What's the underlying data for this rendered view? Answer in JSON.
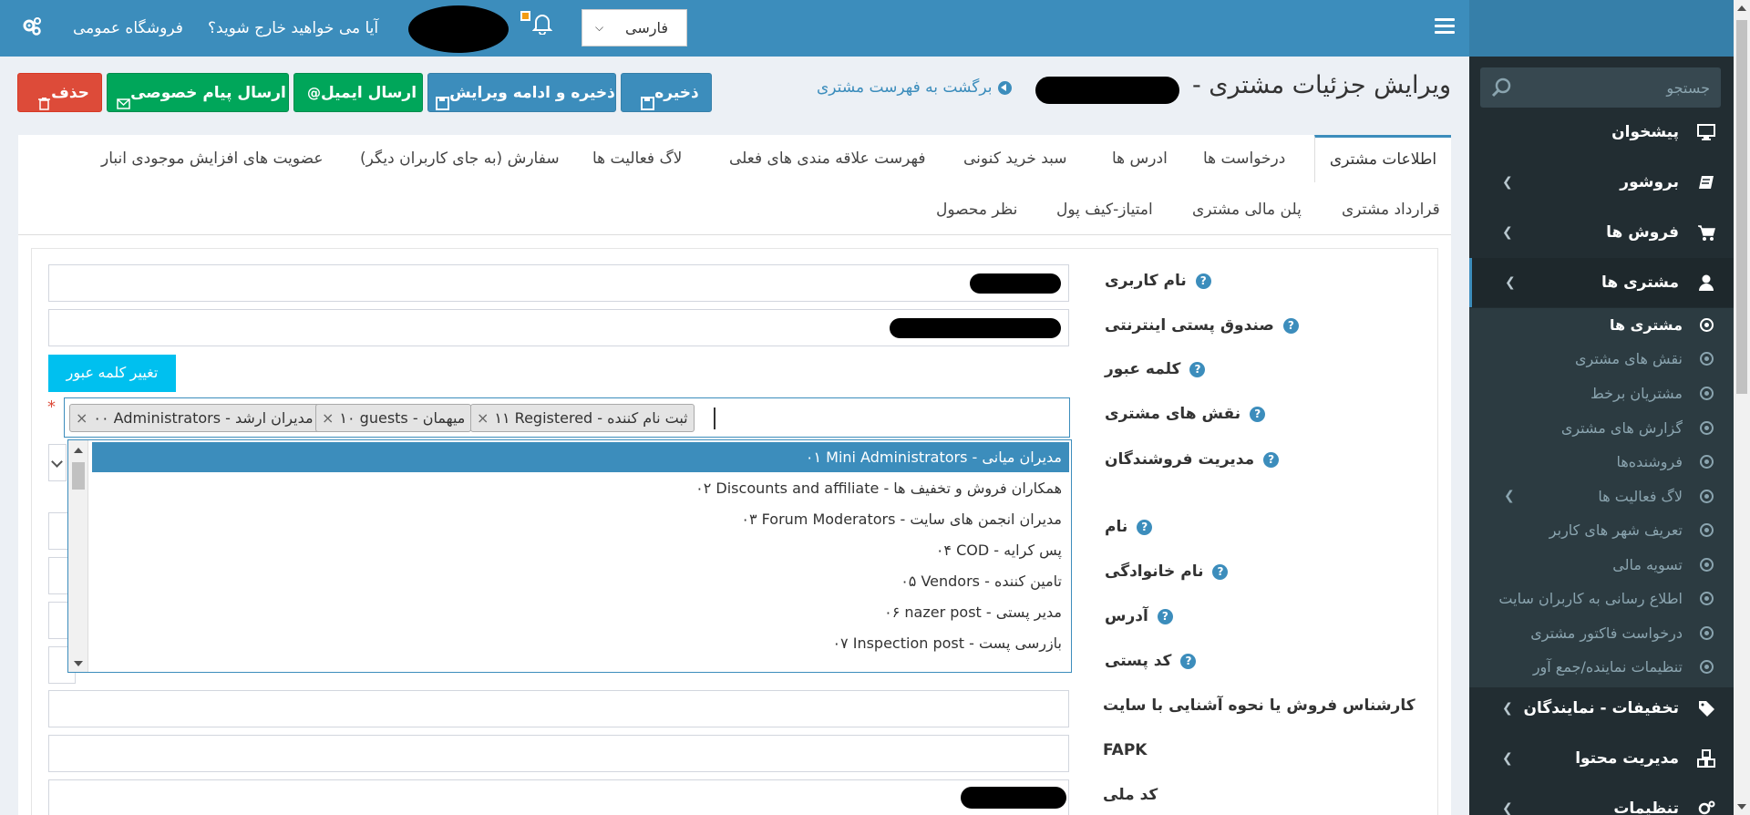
{
  "topbar": {
    "store_link": "فروشگاه عمومی",
    "logout_prompt": "آیا می خواهید خارج شوید؟",
    "language": "فارسی"
  },
  "sidebar": {
    "search_placeholder": "جستجو",
    "items": [
      {
        "label": "پیشخوان",
        "icon": "desktop-icon"
      },
      {
        "label": "بروشور",
        "icon": "book-icon"
      },
      {
        "label": "فروش ها",
        "icon": "cart-icon"
      },
      {
        "label": "مشتری ها",
        "icon": "user-icon"
      }
    ],
    "sub_items": [
      "مشتری ها",
      "نقش های مشتری",
      "مشتریان برخط",
      "گزارش های مشتری",
      "فروشنده‌ها",
      "لاگ فعالیت ها",
      "تعریف شهر های کاربر",
      "تسویه مالی",
      "اطلاع رسانی به کاربران سایت",
      "درخواست فاکتور مشتری",
      "تنظیمات نماینده/جمع آور"
    ],
    "bottom_items": [
      {
        "label": "تخفیفات - نمایندگان",
        "icon": "tag-icon"
      },
      {
        "label": "مدیریت محتوا",
        "icon": "cubes-icon"
      },
      {
        "label": "تنظیمات",
        "icon": "gears-icon"
      }
    ]
  },
  "header": {
    "title": "ویرایش جزئیات مشتری -",
    "back_link": "برگشت به فهرست مشتری"
  },
  "buttons": {
    "save": "ذخیره",
    "save_continue": "ذخیره و ادامه ویرایش",
    "send_email": "ارسال ایمیل",
    "send_pm": "ارسال پیام خصوصی",
    "delete": "حذف"
  },
  "tabs": {
    "row1": [
      "اطلاعات مشتری",
      "درخواست ها",
      "ادرس ها",
      "سبد خرید کنونی",
      "فهرست علاقه مندی های فعلی",
      "لاگ فعالیت ها",
      "سفارش (به جای کاربران دیگر)",
      "عضویت های افزایش موجودی انبار"
    ],
    "row2": [
      "قرارداد مشتری",
      "پلن مالی مشتری",
      "امتیاز-کیف پول",
      "نظر محصول"
    ]
  },
  "form": {
    "labels": {
      "username": "نام کاربری",
      "email": "صندوق پستی اینترنتی",
      "password": "کلمه عبور",
      "roles": "نقش های مشتری",
      "vendor_mgmt": "مدیریت فروشندگان",
      "first_name": "نام",
      "last_name": "نام خانوادگی",
      "address": "آدرس",
      "postal_code": "کد پستی",
      "sales_expert": "کارشناس فروش یا نحوه آشنایی با سایت",
      "fapk": "FAPK",
      "national_code": "کد ملی"
    },
    "change_password": "تغییر کلمه عبور",
    "selected_roles": [
      "۰۰ Administrators - مدیران ارشد",
      "۱۰ guests - میهمان",
      "۱۱ Registered - ثبت نام کننده"
    ],
    "remove_symbol": "×",
    "role_options": [
      "۰۱ Mini Administrators - مدیران میانی",
      "۰۲ Discounts and affiliate - همکاران فروش و تخفیف ها",
      "۰۳ Forum Moderators - مدیران انجمن های سایت",
      "۰۴ COD - پس کرایه",
      "۰۵ Vendors - تامین کننده",
      "۰۶ nazer post - مدیر پستی",
      "۰۷ Inspection post - بازرسی پست"
    ],
    "help_symbol": "?"
  }
}
